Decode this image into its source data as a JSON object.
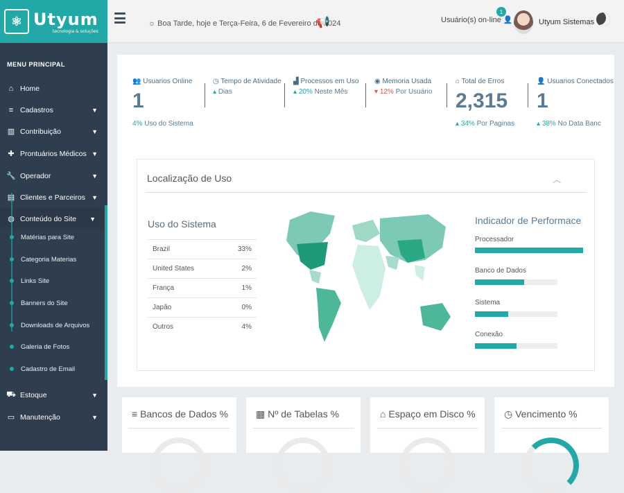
{
  "brand": {
    "logo_text": "Utyum",
    "tagline": "tecnologia & soluções",
    "colors": {
      "accent": "#22a8a6",
      "sidebar": "#2f3e4e"
    }
  },
  "header": {
    "greeting": "Boa Tarde, hoje e Terça-Feira, 6 de Fevereiro de 2024",
    "online_label": "Usuário(s) on-line",
    "online_count": "1",
    "user_name": "Utyum Sistemas"
  },
  "sidebar": {
    "title": "MENU PRINCIPAL",
    "items": [
      {
        "label": "Home",
        "icon": "home-icon"
      },
      {
        "label": "Cadastros",
        "icon": "database-icon"
      },
      {
        "label": "Contribuição",
        "icon": "barcode-icon"
      },
      {
        "label": "Prontuários Médicos",
        "icon": "medkit-icon"
      },
      {
        "label": "Operador",
        "icon": "wrench-icon"
      },
      {
        "label": "Clientes e Parceiros",
        "icon": "building-icon"
      },
      {
        "label": "Conteúdo do Site",
        "icon": "globe-icon"
      },
      {
        "label": "Estoque",
        "icon": "truck-icon"
      },
      {
        "label": "Manutenção",
        "icon": "folder-open-icon"
      }
    ],
    "subitems": [
      "Matérias para Site",
      "Categoria Materias",
      "Links Site",
      "Banners do Site",
      "Downloads de Arquivos",
      "Galeria de Fotos",
      "Cadastro de Email"
    ]
  },
  "stats": [
    {
      "label": "Usuarios Online",
      "value": "1",
      "sub_pct": "4%",
      "sub_text": "Uso do Sistema"
    },
    {
      "label": "Tempo de Atividade",
      "value": "",
      "sub_pct": "",
      "sub_text": "Dias"
    },
    {
      "label": "Processos em Uso",
      "value": "",
      "sub_pct": "20%",
      "sub_text": "Neste Mês"
    },
    {
      "label": "Memoria Usada",
      "value": "",
      "sub_pct": "12%",
      "sub_text": "Por Usuário"
    },
    {
      "label": "Total de Erros",
      "value": "2,315",
      "sub_pct": "34%",
      "sub_text": "Por Paginas"
    },
    {
      "label": "Usuarios Conectados",
      "value": "1",
      "sub_pct": "38%",
      "sub_text": "No Data Banc"
    }
  ],
  "location": {
    "title": "Localização de Uso",
    "usage_title": "Uso do Sistema",
    "rows": [
      {
        "country": "Brazil",
        "pct": "33%"
      },
      {
        "country": "United States",
        "pct": "2%"
      },
      {
        "country": "França",
        "pct": "1%"
      },
      {
        "country": "Japão",
        "pct": "0%"
      },
      {
        "country": "Outros",
        "pct": "4%"
      }
    ],
    "perf_title": "Indicador de Performace",
    "perf": [
      {
        "label": "Processador",
        "level": 1.0
      },
      {
        "label": "Banco de Dados",
        "level": 0.6
      },
      {
        "label": "Sistema",
        "level": 0.4
      },
      {
        "label": "Conexão",
        "level": 0.5
      }
    ]
  },
  "bottom_cards": [
    {
      "title": "Bancos de Dados  %",
      "icon": "database-icon"
    },
    {
      "title": "Nº de Tabelas  %",
      "icon": "table-icon"
    },
    {
      "title": "Espaço em Disco  %",
      "icon": "hdd-icon"
    },
    {
      "title": "Vencimento  %",
      "icon": "clock-icon"
    }
  ]
}
